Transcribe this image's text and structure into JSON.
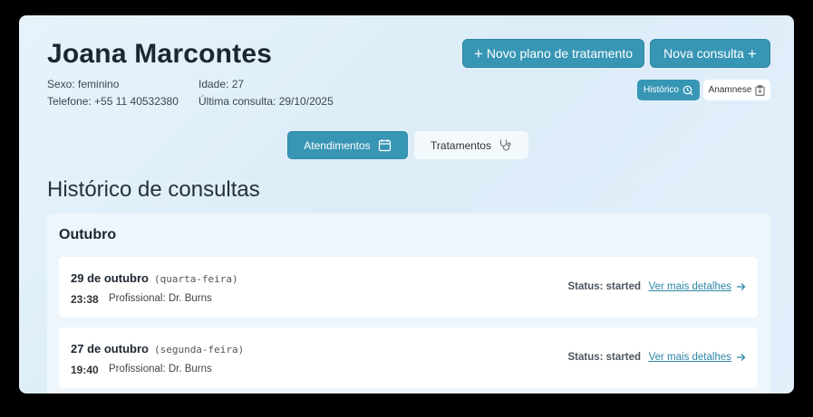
{
  "patient": {
    "name": "Joana Marcontes",
    "sex": "Sexo: feminino",
    "age": "Idade: 27",
    "phone": "Telefone: +55 11 40532380",
    "last_visit": "Última consulta: 29/10/2025"
  },
  "actions": {
    "new_plan": "Novo plano de tratamento",
    "new_visit": "Nova consulta",
    "history": "Histórico",
    "anamnesis": "Anamnese"
  },
  "tabs": [
    {
      "label": "Atendimentos",
      "active": true
    },
    {
      "label": "Tratamentos",
      "active": false
    }
  ],
  "section_title": "Histórico de consultas",
  "month": "Outubro",
  "visits": [
    {
      "date": "29 de outubro",
      "weekday": "(quarta-feira)",
      "time": "23:38",
      "professional": "Profissional: Dr. Burns",
      "status": "Status: started",
      "link": "Ver mais detalhes"
    },
    {
      "date": "27 de outubro",
      "weekday": "(segunda-feira)",
      "time": "19:40",
      "professional": "Profissional: Dr. Burns",
      "status": "Status: started",
      "link": "Ver mais detalhes"
    }
  ],
  "colors": {
    "accent": "#3896b5",
    "link": "#2d86a6"
  }
}
